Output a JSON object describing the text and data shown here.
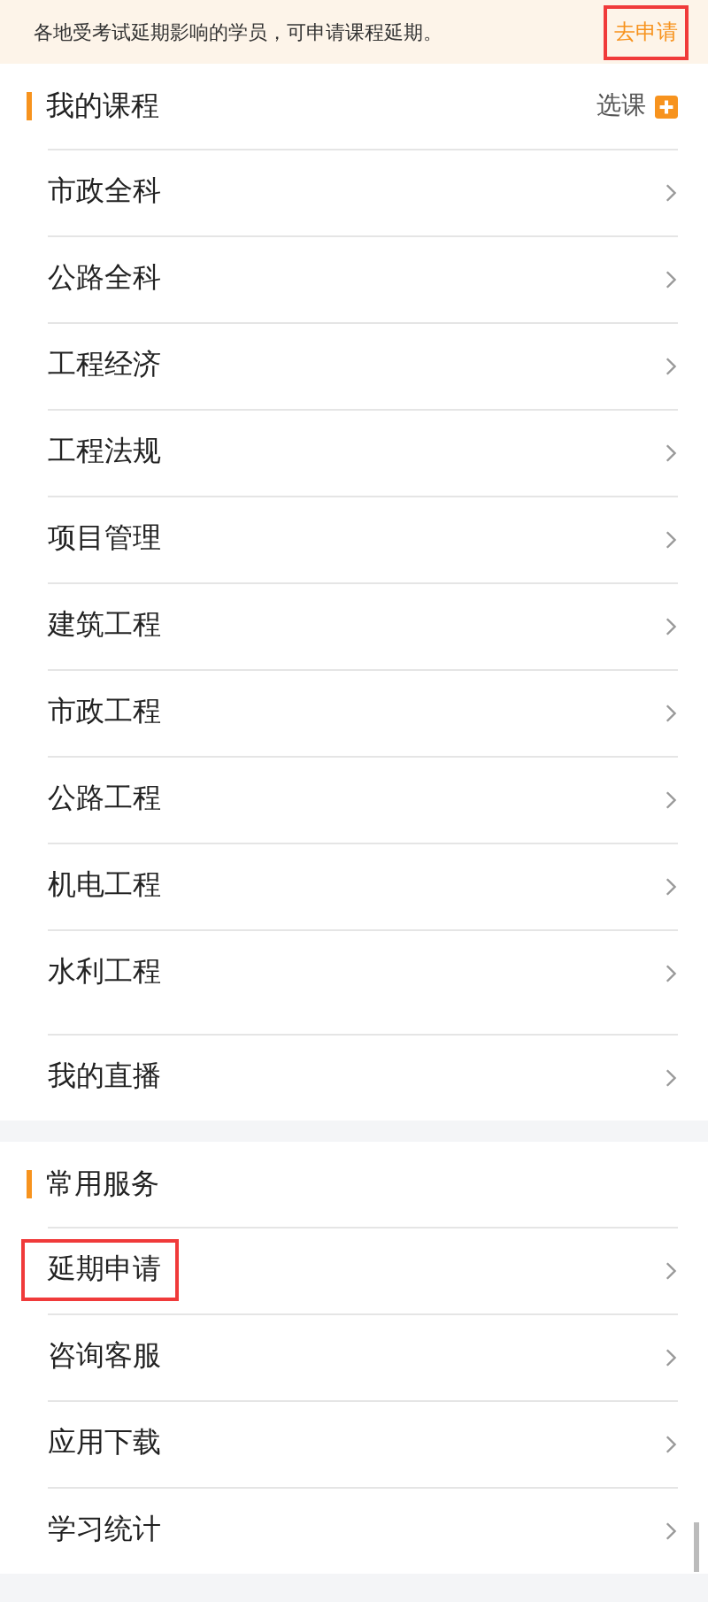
{
  "notice": {
    "text": "各地受考试延期影响的学员，可申请课程延期。",
    "link": "去申请",
    "link_highlighted": true
  },
  "sections": [
    {
      "title": "我的课程",
      "action": "选课",
      "groups": [
        [
          {
            "label": "市政全科",
            "highlighted": false
          },
          {
            "label": "公路全科",
            "highlighted": false
          },
          {
            "label": "工程经济",
            "highlighted": false
          },
          {
            "label": "工程法规",
            "highlighted": false
          },
          {
            "label": "项目管理",
            "highlighted": false
          },
          {
            "label": "建筑工程",
            "highlighted": false
          },
          {
            "label": "市政工程",
            "highlighted": false
          },
          {
            "label": "公路工程",
            "highlighted": false
          },
          {
            "label": "机电工程",
            "highlighted": false
          },
          {
            "label": "水利工程",
            "highlighted": false
          }
        ],
        [
          {
            "label": "我的直播",
            "highlighted": false
          }
        ]
      ]
    },
    {
      "title": "常用服务",
      "groups": [
        [
          {
            "label": "延期申请",
            "highlighted": true
          },
          {
            "label": "咨询客服",
            "highlighted": false
          },
          {
            "label": "应用下载",
            "highlighted": false
          },
          {
            "label": "学习统计",
            "highlighted": false
          }
        ]
      ]
    }
  ]
}
